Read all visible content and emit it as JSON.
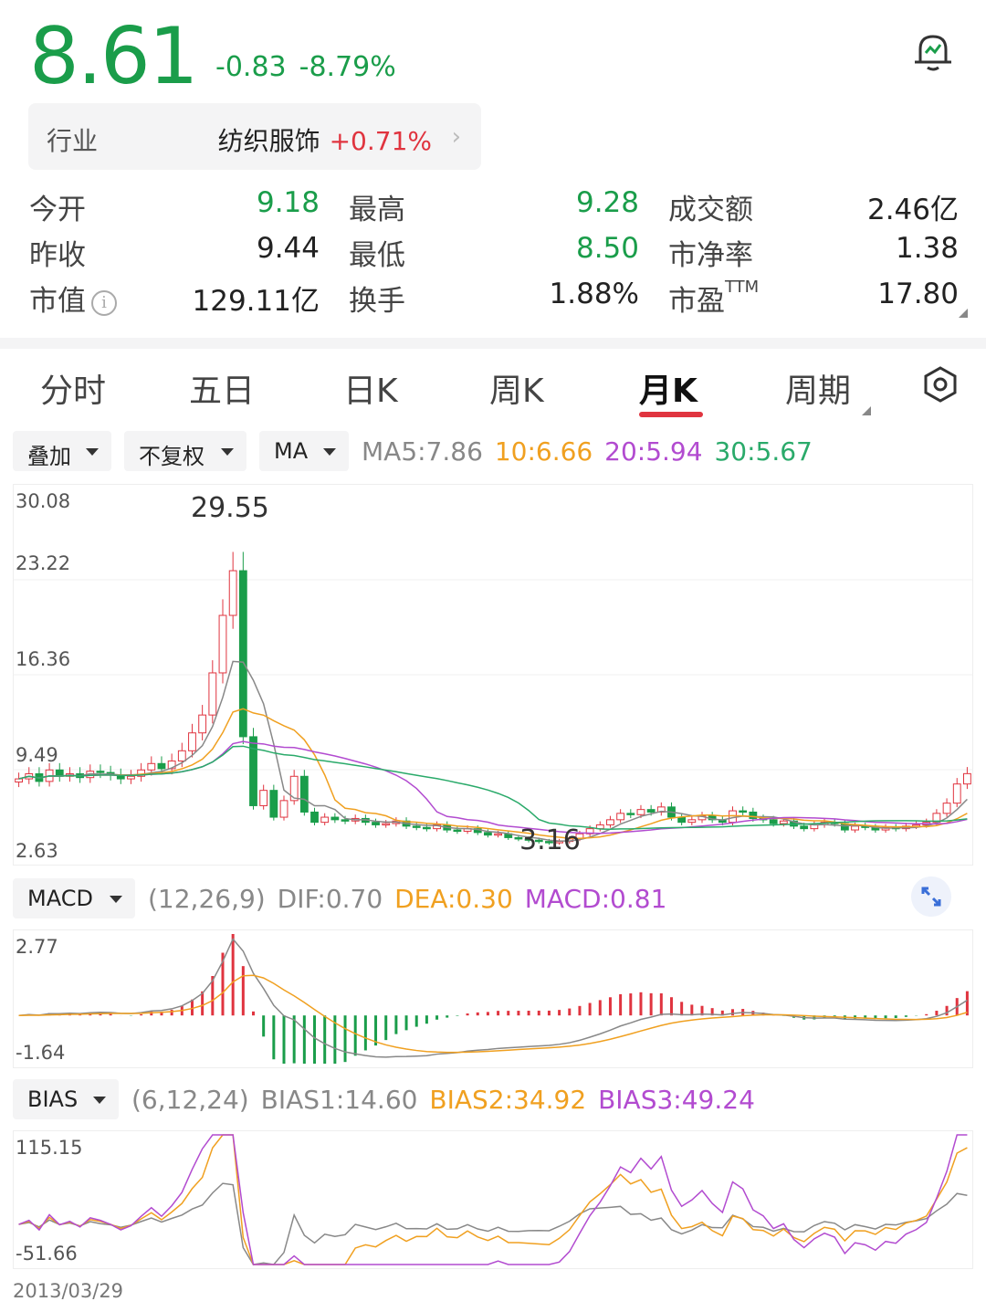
{
  "quote": {
    "price": "8.61",
    "change": "-0.83",
    "change_pct": "-8.79%",
    "industry_label": "行业",
    "industry_name": "纺织服饰",
    "industry_pct": "+0.71%",
    "rows": [
      [
        {
          "label": "今开",
          "value": "9.18"
        },
        {
          "label": "最高",
          "value": "9.28"
        },
        {
          "label": "成交额",
          "value": "2.46亿"
        }
      ],
      [
        {
          "label": "昨收",
          "value": "9.44"
        },
        {
          "label": "最低",
          "value": "8.50"
        },
        {
          "label": "市净率",
          "value": "1.38"
        }
      ],
      [
        {
          "label": "市值",
          "value": "129.11亿"
        },
        {
          "label": "换手",
          "value": "1.88%"
        },
        {
          "label": "市盈",
          "value": "17.80",
          "sup": "TTM"
        }
      ]
    ],
    "colors": {
      "down": "#1a9d4a",
      "up": "#e0343f"
    }
  },
  "tabs": [
    {
      "label": "分时"
    },
    {
      "label": "五日"
    },
    {
      "label": "日K"
    },
    {
      "label": "周K"
    },
    {
      "label": "月K",
      "active": true
    },
    {
      "label": "周期"
    }
  ],
  "controls": {
    "overlay": "叠加",
    "adjust": "不复权",
    "ma": "MA",
    "ma5": "MA5:7.86",
    "ma10": "10:6.66",
    "ma20": "20:5.94",
    "ma30": "30:5.67"
  },
  "main_chart": {
    "y_ticks": [
      "30.08",
      "23.22",
      "16.36",
      "9.49",
      "2.63"
    ],
    "high_label": "29.55",
    "low_label": "3.16"
  },
  "macd": {
    "dropdown": "MACD",
    "params": "(12,26,9)",
    "dif": "DIF:0.70",
    "dea": "DEA:0.30",
    "macd": "MACD:0.81",
    "y_ticks": [
      "2.77",
      "-1.64"
    ]
  },
  "bias": {
    "dropdown": "BIAS",
    "params": "(6,12,24)",
    "b1": "BIAS1:14.60",
    "b2": "BIAS2:34.92",
    "b3": "BIAS3:49.24",
    "y_ticks": [
      "115.15",
      "-51.66"
    ]
  },
  "start_date": "2013/03/29",
  "chart_data": [
    {
      "type": "candlestick",
      "title": "月K",
      "ylim": [
        2.63,
        30.08
      ],
      "series": [
        {
          "name": "close",
          "values": [
            8.2,
            8.6,
            8.0,
            8.9,
            8.4,
            8.6,
            8.3,
            8.8,
            8.7,
            8.5,
            8.2,
            8.4,
            8.9,
            9.4,
            9.0,
            9.6,
            10.4,
            11.8,
            13.2,
            16.5,
            21.0,
            24.5,
            11.5,
            6.1,
            7.3,
            5.2,
            6.5,
            8.4,
            5.6,
            4.8,
            5.2,
            5.0,
            4.9,
            5.1,
            4.8,
            4.6,
            4.7,
            4.9,
            4.5,
            4.4,
            4.3,
            4.6,
            4.2,
            4.1,
            4.3,
            4.0,
            3.8,
            3.9,
            3.6,
            3.5,
            3.4,
            3.3,
            3.2,
            3.3,
            3.5,
            3.9,
            4.3,
            4.6,
            5.0,
            5.5,
            5.4,
            5.8,
            5.6,
            6.0,
            5.2,
            4.8,
            5.0,
            5.3,
            5.0,
            4.8,
            5.7,
            5.6,
            5.1,
            5.0,
            4.7,
            4.9,
            4.5,
            4.3,
            4.6,
            4.8,
            4.7,
            4.2,
            4.5,
            4.4,
            4.2,
            4.4,
            4.3,
            4.5,
            4.6,
            4.8,
            5.5,
            6.3,
            7.8,
            8.61
          ]
        },
        {
          "name": "MA5",
          "values": [
            7.86
          ]
        },
        {
          "name": "MA10",
          "values": [
            6.66
          ]
        },
        {
          "name": "MA20",
          "values": [
            5.94
          ]
        },
        {
          "name": "MA30",
          "values": [
            5.67
          ]
        }
      ]
    },
    {
      "type": "bar",
      "title": "MACD",
      "ylim": [
        -1.64,
        2.77
      ],
      "series": [
        {
          "name": "DIF",
          "values": [
            0.7
          ]
        },
        {
          "name": "DEA",
          "values": [
            0.3
          ]
        },
        {
          "name": "MACD",
          "values": [
            0.81
          ]
        }
      ]
    },
    {
      "type": "line",
      "title": "BIAS",
      "ylim": [
        -51.66,
        115.15
      ],
      "series": [
        {
          "name": "BIAS1",
          "values": [
            14.6
          ]
        },
        {
          "name": "BIAS2",
          "values": [
            34.92
          ]
        },
        {
          "name": "BIAS3",
          "values": [
            49.24
          ]
        }
      ]
    }
  ]
}
